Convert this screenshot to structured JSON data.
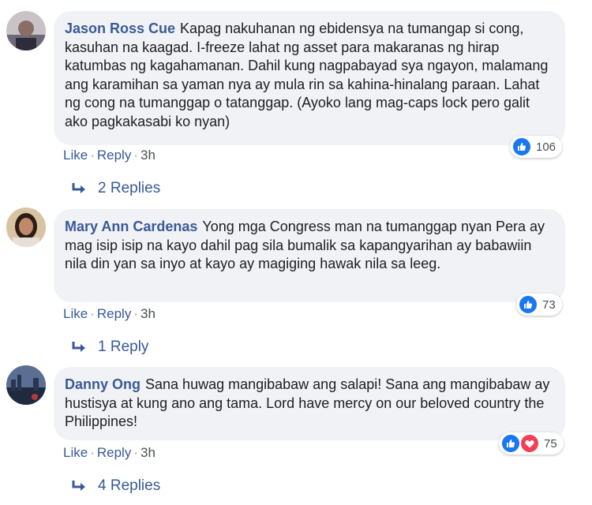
{
  "comments": [
    {
      "author": "Jason Ross Cue",
      "text": "Kapag nakuhanan ng ebidensya na tumangap si cong, kasuhan na kaagad. I-freeze lahat ng asset para makaranas ng hirap katumbas ng kagahamanan. Dahil kung nagpabayad sya ngayon, malamang ang karamihan sa yaman nya ay mula rin sa kahina-hinalang paraan. Lahat ng cong na tumanggap o tatanggap. (Ayoko lang mag-caps lock pero galit ako pagkakasabi ko nyan)",
      "like_label": "Like",
      "reply_label": "Reply",
      "time": "3h",
      "reaction_count": "106",
      "replies_label": "2 Replies"
    },
    {
      "author": "Mary Ann Cardenas",
      "text": "Yong mga Congress man na tumanggap nyan Pera ay mag isip isip na kayo dahil pag sila bumalik sa kapangyarihan ay babawiin nila din yan sa inyo at kayo ay magiging hawak nila sa leeg.",
      "like_label": "Like",
      "reply_label": "Reply",
      "time": "3h",
      "reaction_count": "73",
      "replies_label": "1 Reply"
    },
    {
      "author": "Danny Ong",
      "text": "Sana huwag mangibabaw ang salapi! Sana ang mangibabaw ay hustisya at kung ano ang tama. Lord have mercy on our beloved country the Philippines!",
      "like_label": "Like",
      "reply_label": "Reply",
      "time": "3h",
      "reaction_count": "75",
      "replies_label": "4 Replies"
    }
  ],
  "colors": {
    "author": "#3b5998",
    "link": "#385898",
    "bubble": "#f0f2f5",
    "like": "#1877f2",
    "heart": "#f33e58"
  }
}
